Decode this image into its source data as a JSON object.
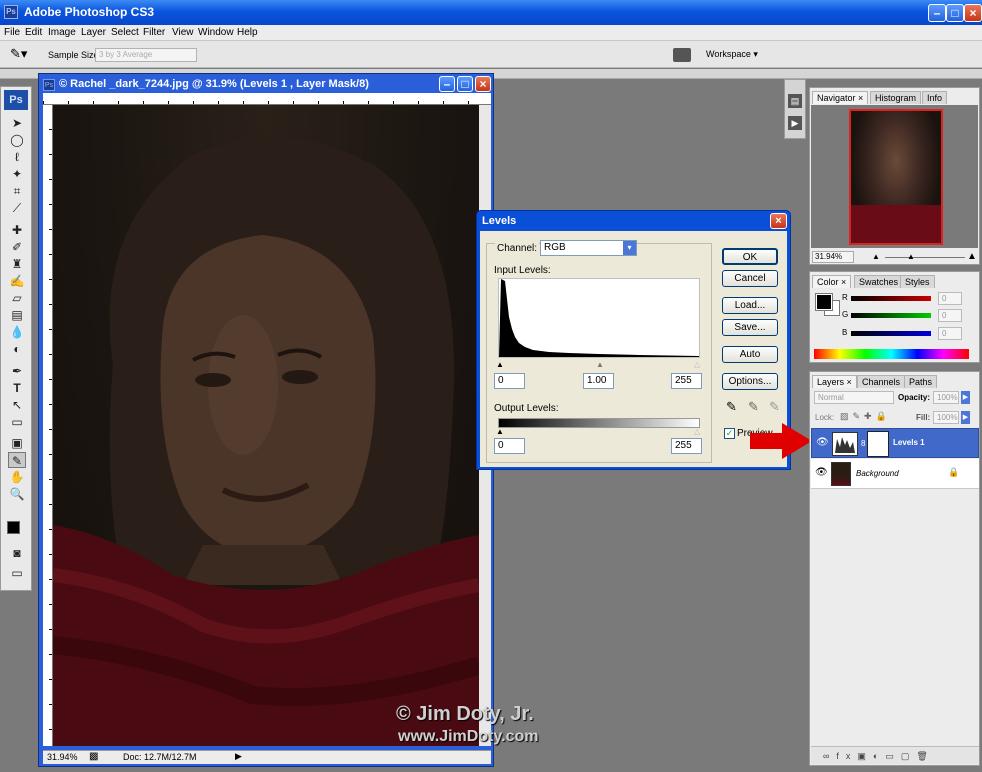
{
  "app": {
    "title": "Adobe Photoshop CS3",
    "icon_text": "Ps"
  },
  "menu": [
    "File",
    "Edit",
    "Image",
    "Layer",
    "Select",
    "Filter",
    "View",
    "Window",
    "Help"
  ],
  "options_bar": {
    "sample_size_label": "Sample Size:",
    "sample_size_value": "3 by 3 Average",
    "workspace_label": "Workspace"
  },
  "document": {
    "title": "© Rachel _dark_7244.jpg @ 31.9% (Levels 1 , Layer Mask/8)",
    "zoom": "31.94%",
    "doc_info": "Doc: 12.7M/12.7M"
  },
  "levels": {
    "title": "Levels",
    "channel_label": "Channel:",
    "channel_value": "RGB",
    "input_label": "Input Levels:",
    "input_black": "0",
    "input_gamma": "1.00",
    "input_white": "255",
    "output_label": "Output Levels:",
    "output_black": "0",
    "output_white": "255",
    "buttons": {
      "ok": "OK",
      "cancel": "Cancel",
      "load": "Load...",
      "save": "Save...",
      "auto": "Auto",
      "options": "Options..."
    },
    "preview_label": "Preview",
    "preview_checked": true
  },
  "navigator": {
    "tabs": [
      "Navigator",
      "Histogram",
      "Info"
    ],
    "zoom": "31.94%"
  },
  "color_panel": {
    "tabs": [
      "Color",
      "Swatches",
      "Styles"
    ],
    "labels": [
      "R",
      "G",
      "B"
    ],
    "values": [
      "0",
      "0",
      "0"
    ]
  },
  "layers_panel": {
    "tabs": [
      "Layers",
      "Channels",
      "Paths"
    ],
    "blend_mode": "Normal",
    "opacity_label": "Opacity:",
    "opacity_value": "100%",
    "lock_label": "Lock:",
    "fill_label": "Fill:",
    "fill_value": "100%",
    "layers": [
      {
        "name": "Levels 1",
        "selected": true
      },
      {
        "name": "Background",
        "selected": false
      }
    ]
  },
  "watermark": {
    "line1": "© Jim Doty, Jr.",
    "line2": "www.JimDoty.com"
  },
  "colors": {
    "xp_blue": "#0a55df",
    "selected_layer": "#4169c9",
    "arrow_red": "#e00000"
  }
}
